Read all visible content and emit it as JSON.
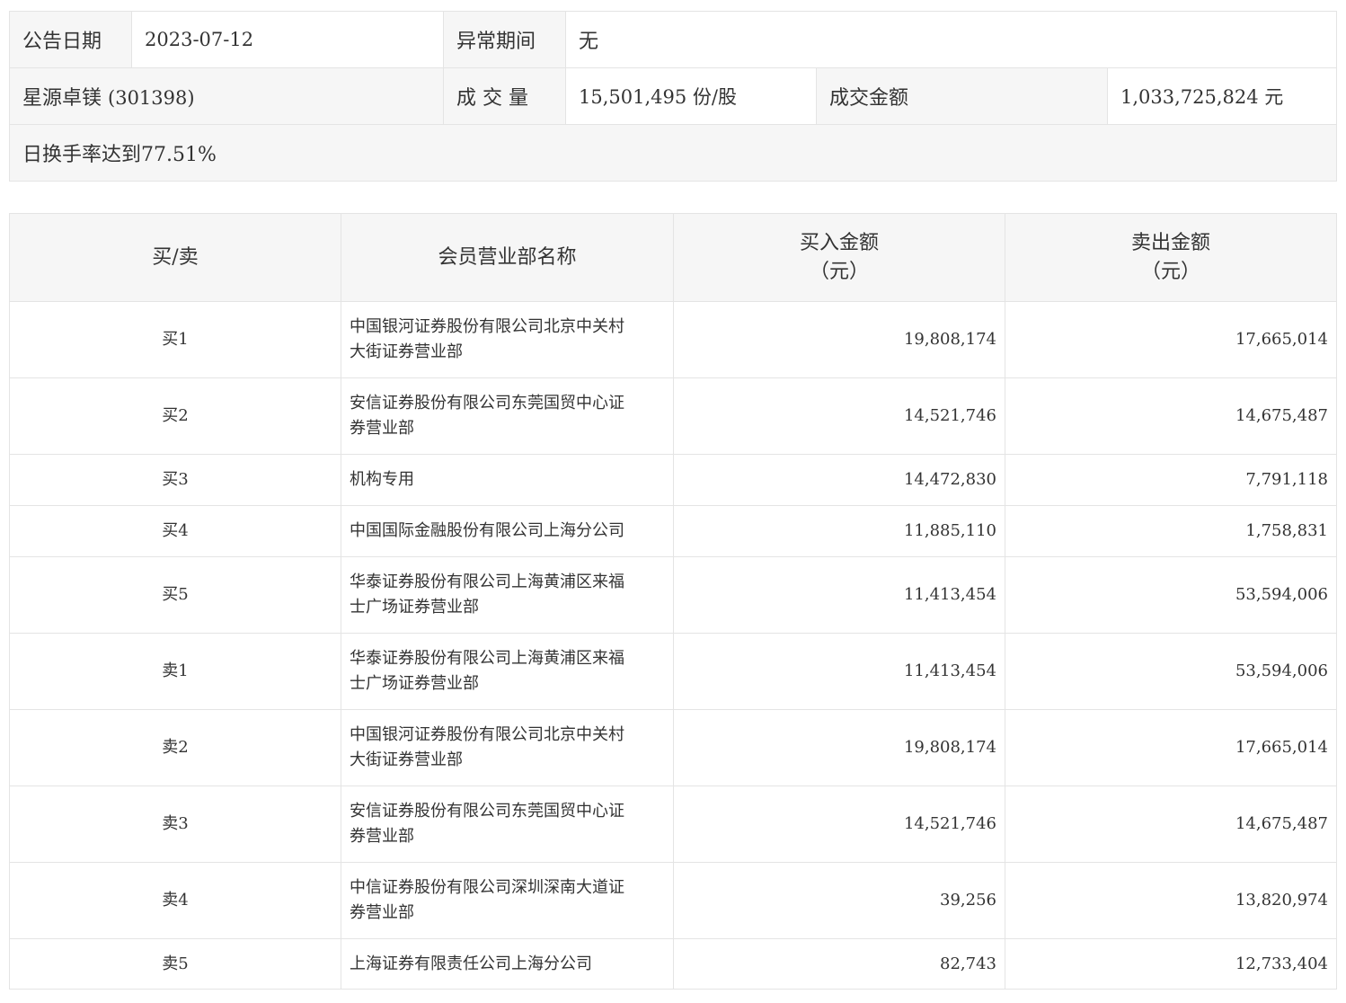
{
  "summary": {
    "announce_date_label": "公告日期",
    "announce_date": "2023-07-12",
    "abnormal_period_label": "异常期间",
    "abnormal_period": "无",
    "stock_name": "星源卓镁",
    "stock_code": "(301398)",
    "volume_label": "成 交 量",
    "volume_value": "15,501,495 份/股",
    "turnover_label": "成交金额",
    "turnover_value": "1,033,725,824 元",
    "note": "日换手率达到77.51%"
  },
  "table": {
    "headers": {
      "side": "买/卖",
      "branch": "会员营业部名称",
      "buy_line1": "买入金额",
      "buy_line2": "（元）",
      "sell_line1": "卖出金额",
      "sell_line2": "（元）"
    },
    "rows": [
      {
        "side": "买1",
        "branch_line1": "中国银河证券股份有限公司北京中关村",
        "branch_line2": "大街证券营业部",
        "buy": "19,808,174",
        "sell": "17,665,014"
      },
      {
        "side": "买2",
        "branch_line1": "安信证券股份有限公司东莞国贸中心证",
        "branch_line2": "券营业部",
        "buy": "14,521,746",
        "sell": "14,675,487"
      },
      {
        "side": "买3",
        "branch_line1": "机构专用",
        "branch_line2": "",
        "buy": "14,472,830",
        "sell": "7,791,118"
      },
      {
        "side": "买4",
        "branch_line1": "中国国际金融股份有限公司上海分公司",
        "branch_line2": "",
        "buy": "11,885,110",
        "sell": "1,758,831"
      },
      {
        "side": "买5",
        "branch_line1": "华泰证券股份有限公司上海黄浦区来福",
        "branch_line2": "士广场证券营业部",
        "buy": "11,413,454",
        "sell": "53,594,006"
      },
      {
        "side": "卖1",
        "branch_line1": "华泰证券股份有限公司上海黄浦区来福",
        "branch_line2": "士广场证券营业部",
        "buy": "11,413,454",
        "sell": "53,594,006"
      },
      {
        "side": "卖2",
        "branch_line1": "中国银河证券股份有限公司北京中关村",
        "branch_line2": "大街证券营业部",
        "buy": "19,808,174",
        "sell": "17,665,014"
      },
      {
        "side": "卖3",
        "branch_line1": "安信证券股份有限公司东莞国贸中心证",
        "branch_line2": "券营业部",
        "buy": "14,521,746",
        "sell": "14,675,487"
      },
      {
        "side": "卖4",
        "branch_line1": "中信证券股份有限公司深圳深南大道证",
        "branch_line2": "券营业部",
        "buy": "39,256",
        "sell": "13,820,974"
      },
      {
        "side": "卖5",
        "branch_line1": "上海证券有限责任公司上海分公司",
        "branch_line2": "",
        "buy": "82,743",
        "sell": "12,733,404"
      }
    ]
  }
}
